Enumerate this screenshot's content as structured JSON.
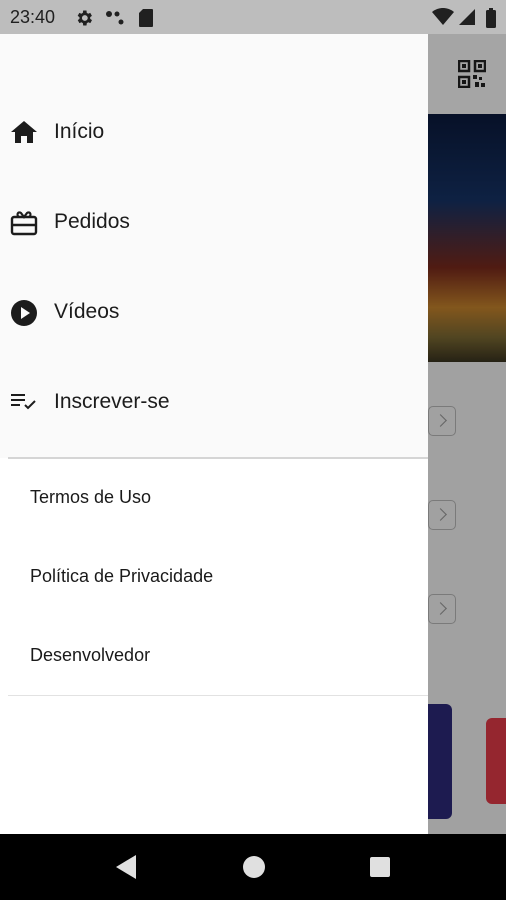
{
  "status_bar": {
    "time": "23:40",
    "left_icons": [
      "settings-icon",
      "dots-icon",
      "sd-card-icon"
    ],
    "right_icons": [
      "wifi-icon",
      "signal-icon",
      "battery-icon"
    ]
  },
  "drawer": {
    "items": [
      {
        "label": "Início",
        "icon": "home-icon"
      },
      {
        "label": "Pedidos",
        "icon": "gift-card-icon"
      },
      {
        "label": "Vídeos",
        "icon": "play-circle-icon"
      },
      {
        "label": "Inscrever-se",
        "icon": "playlist-check-icon"
      }
    ],
    "links": [
      {
        "label": "Termos de Uso"
      },
      {
        "label": "Política de Privacidade"
      },
      {
        "label": "Desenvolvedor"
      }
    ]
  },
  "background": {
    "toolbar_icon": "qr-code-icon"
  },
  "nav_bar": {
    "buttons": [
      "back-icon",
      "home-circle-icon",
      "recents-icon"
    ]
  },
  "colors": {
    "status_bar": "#bdbdbd",
    "drawer": "#fafafa",
    "text": "#1c1c1c",
    "nav_bar": "#000000"
  }
}
